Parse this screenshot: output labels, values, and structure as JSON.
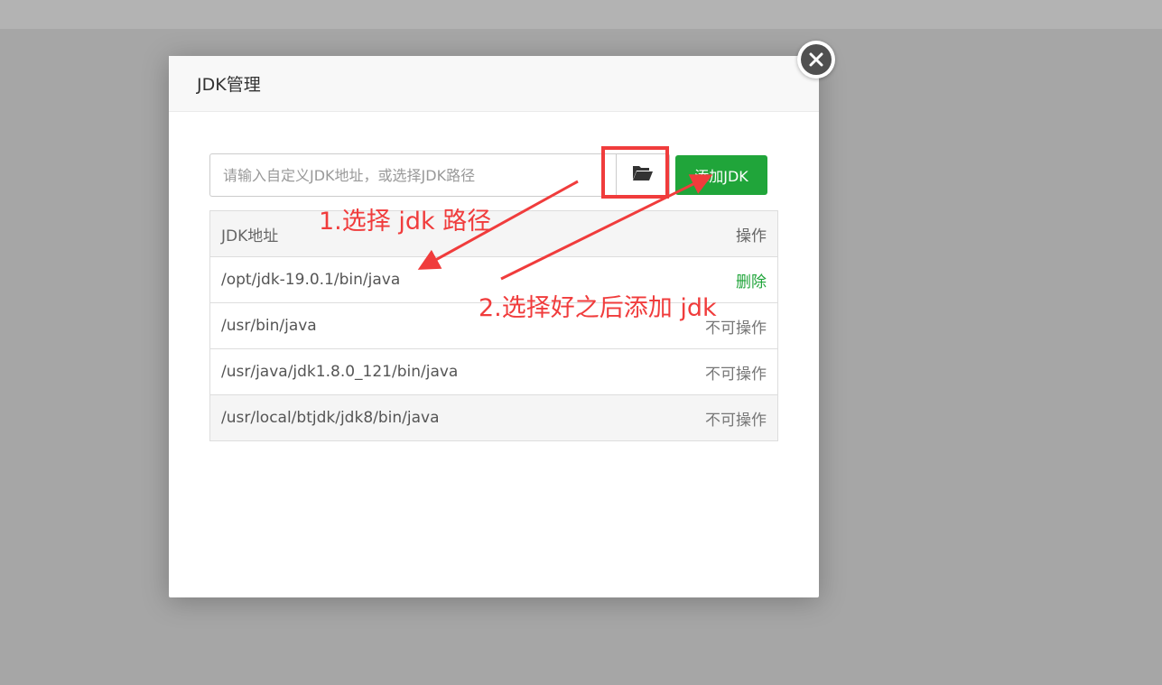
{
  "modal": {
    "title": "JDK管理",
    "close_icon": "close-icon",
    "input_placeholder": "请输入自定义JDK地址，或选择JDK路径",
    "folder_icon": "folder-open-icon",
    "add_button_label": "添加JDK"
  },
  "table": {
    "headers": {
      "address": "JDK地址",
      "operation": "操作"
    },
    "rows": [
      {
        "path": "/opt/jdk-19.0.1/bin/java",
        "operation": "删除"
      },
      {
        "path": "/usr/bin/java",
        "operation": "不可操作"
      },
      {
        "path": "/usr/java/jdk1.8.0_121/bin/java",
        "operation": "不可操作"
      },
      {
        "path": "/usr/local/btjdk/jdk8/bin/java",
        "operation": "不可操作"
      }
    ]
  },
  "annotations": {
    "step1": "1.选择 jdk 路径",
    "step2": "2.选择好之后添加 jdk"
  },
  "colors": {
    "accent_green": "#20a53a",
    "annotation_red": "#f03c3c",
    "overlay_gray": "#a6a6a6"
  }
}
